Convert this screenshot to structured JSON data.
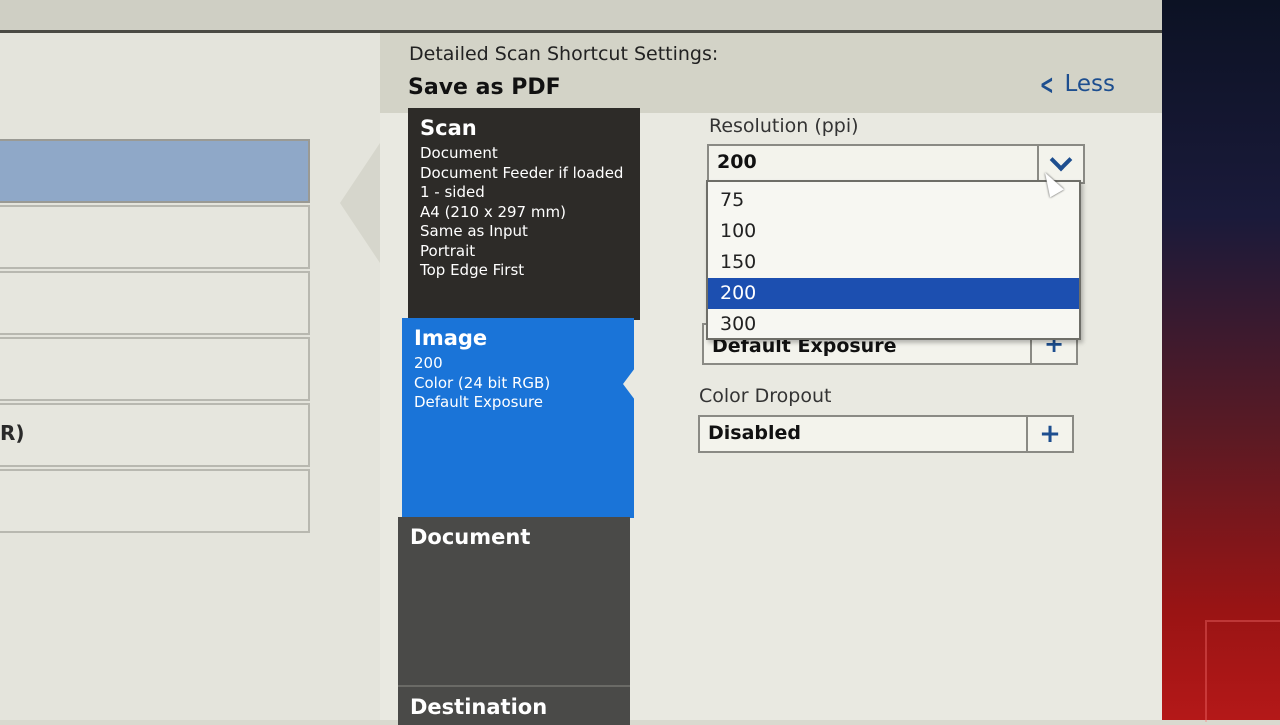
{
  "dialog": {
    "title": "Detailed Scan Shortcut Settings:",
    "shortcut_name": "Save as PDF",
    "less_label": "Less"
  },
  "left_list": {
    "partial_text": "R)"
  },
  "tabs": {
    "scan": {
      "title": "Scan",
      "lines": [
        "Document",
        "Document Feeder if loaded",
        "1 - sided",
        "A4 (210 x 297 mm)",
        "Same as Input",
        "Portrait",
        "Top Edge First"
      ]
    },
    "image": {
      "title": "Image",
      "lines": [
        "200",
        "Color (24 bit RGB)",
        "Default Exposure"
      ]
    },
    "document": {
      "title": "Document"
    },
    "destination": {
      "title": "Destination"
    }
  },
  "resolution": {
    "label": "Resolution (ppi)",
    "value": "200",
    "options": [
      "75",
      "100",
      "150",
      "200",
      "300"
    ],
    "selected_option": "200"
  },
  "exposure": {
    "value": "Default Exposure"
  },
  "color_dropout": {
    "label": "Color Dropout",
    "value": "Disabled"
  },
  "colors": {
    "active_tab": "#1a74d8",
    "selected_option": "#1c4fb0",
    "link": "#1d4e8f"
  }
}
